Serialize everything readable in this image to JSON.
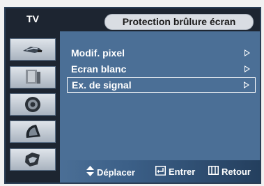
{
  "header": {
    "tab_label": "TV",
    "title": "Protection brûlure écran"
  },
  "sidebar": {
    "items": [
      {
        "icon": "antenna-icon"
      },
      {
        "icon": "display-icon"
      },
      {
        "icon": "speaker-icon"
      },
      {
        "icon": "satellite-dish-icon"
      },
      {
        "icon": "setup-tools-icon"
      }
    ]
  },
  "menu": {
    "items": [
      {
        "label": "Modif. pixel",
        "selected": false
      },
      {
        "label": "Ecran blanc",
        "selected": false
      },
      {
        "label": "Ex. de signal",
        "selected": true
      }
    ]
  },
  "nav": {
    "move_label": "Déplacer",
    "enter_label": "Entrer",
    "return_label": "Retour"
  },
  "colors": {
    "panel": "#4b6f96",
    "dark": "#1d2531",
    "title_pill": "#d9dde3",
    "text": "#ffffff"
  }
}
